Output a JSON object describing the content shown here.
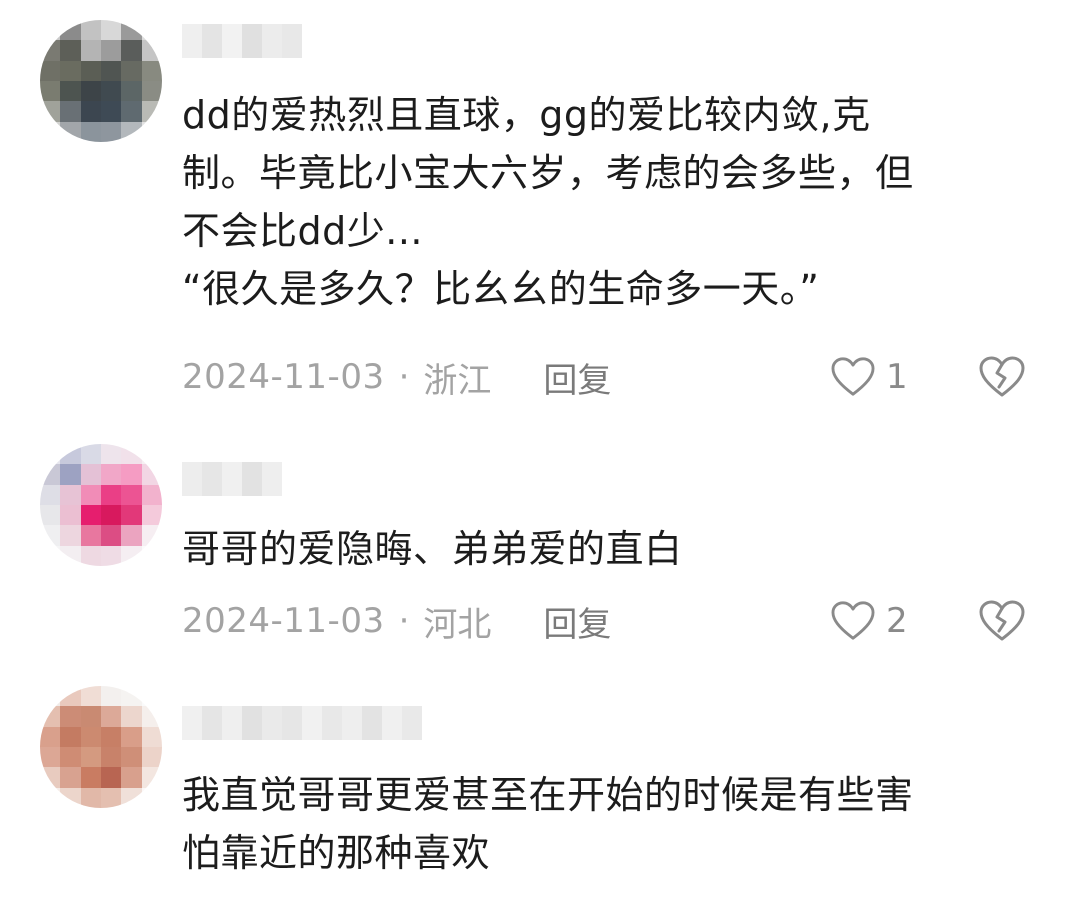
{
  "comments": [
    {
      "text": "dd的爱热烈且直球，gg的爱比较内敛,克\n制。毕竟比小宝大六岁，考虑的会多些，但\n不会比dd少...\n“很久是多久？比幺幺的生命多一天。”",
      "date": "2024-11-03",
      "separator": "·",
      "location": "浙江",
      "reply_label": "回复",
      "likes": "1",
      "like_icon": "heart-outline-icon",
      "dislike_icon": "broken-heart-icon"
    },
    {
      "text": "哥哥的爱隐晦、弟弟爱的直白",
      "date": "2024-11-03",
      "separator": "·",
      "location": "河北",
      "reply_label": "回复",
      "likes": "2",
      "like_icon": "heart-outline-icon",
      "dislike_icon": "broken-heart-icon"
    },
    {
      "text": "我直觉哥哥更爱甚至在开始的时候是有些害\n怕靠近的那种喜欢"
    }
  ],
  "colors": {
    "meta_text": "#a3a3a3",
    "reply_text": "#7a7a7a",
    "icon_stroke": "#8a8a8a"
  }
}
